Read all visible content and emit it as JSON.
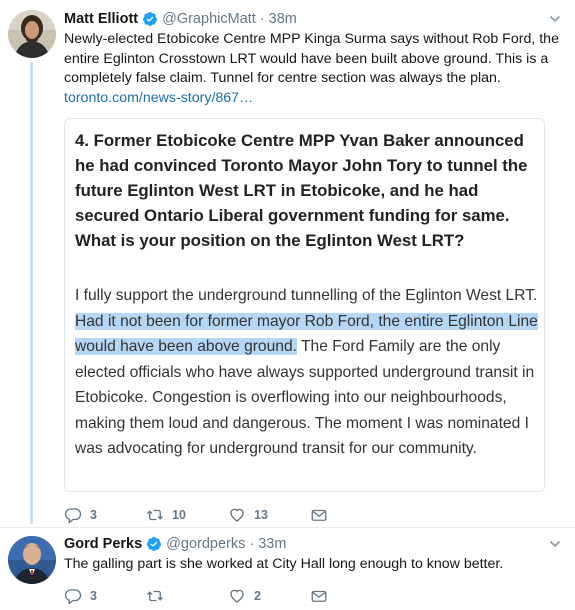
{
  "tweet1": {
    "name": "Matt Elliott",
    "handle": "@GraphicMatt",
    "dot": "·",
    "time": "38m",
    "text": "Newly-elected Etobicoke Centre MPP Kinga Surma says without Rob Ford, the entire Eglinton Crosstown LRT would have been built above ground. This is a completely false claim. Tunnel for centre section was always the plan.",
    "link": "toronto.com/news-story/867…",
    "quote": {
      "question": "4. Former Etobicoke Centre MPP Yvan Baker announced he had convinced Toronto Mayor John Tory to tunnel the future Eglinton West LRT in Etobicoke, and he had secured Ontario Liberal government funding for same. What is your position on the Eglinton West LRT?",
      "answer_before": "I fully support the underground tunnelling of the Eglinton West LRT. ",
      "answer_highlight": "Had it not been for former mayor Rob Ford, the entire Eglinton Line would have been above ground.",
      "answer_after": " The Ford Family are the only elected officials who have always supported underground transit in Etobicoke. Congestion is overflowing into our neighbourhoods, making them loud and dangerous. The moment I was nominated I was advocating for underground transit for our community."
    },
    "actions": {
      "replies": "3",
      "retweets": "10",
      "likes": "13"
    }
  },
  "tweet2": {
    "name": "Gord Perks",
    "handle": "@gordperks",
    "dot": "·",
    "time": "33m",
    "text": "The galling part is she worked at City Hall long enough to know better.",
    "actions": {
      "replies": "3",
      "retweets": "",
      "likes": "2"
    }
  },
  "colors": {
    "link": "#1b6fa8",
    "verified": "#1da1f2",
    "thread_line": "#c4dff0",
    "highlight": "#b4d7f6",
    "action_gray": "#657786"
  },
  "icons": {
    "reply": "reply-icon",
    "retweet": "retweet-icon",
    "like": "heart-icon",
    "message": "envelope-icon",
    "verified": "verified-badge-icon",
    "more": "chevron-down-icon"
  }
}
